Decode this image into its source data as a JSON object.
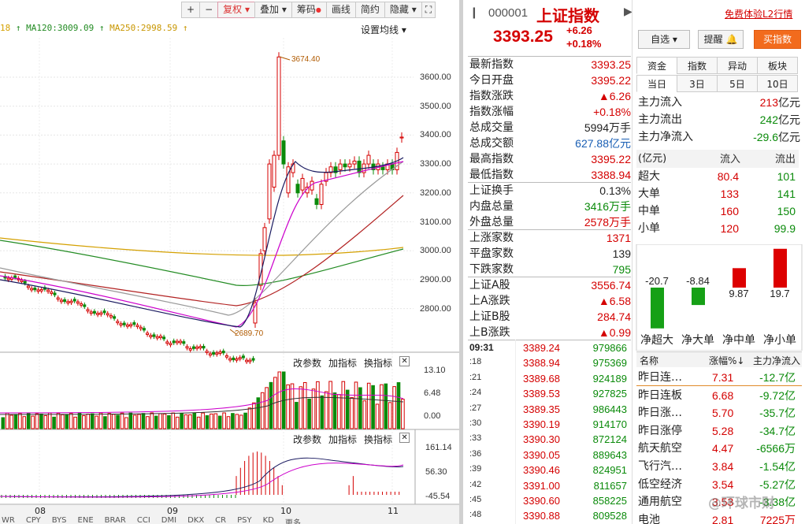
{
  "toolbar": {
    "plus": "+",
    "minus": "−",
    "fuquan": "复权",
    "diejia": "叠加",
    "chouma": "筹码",
    "huaxian": "画线",
    "jianyue": "简约",
    "yincang": "隐藏"
  },
  "ma_legend": {
    "ma_prefix": "18",
    "ma120": "MA120:3009.09",
    "ma250": "MA250:2998.59",
    "arrow": "↑"
  },
  "set_ma": "设置均线",
  "price_labels": [
    "3600.00",
    "3500.00",
    "3400.00",
    "3300.00",
    "3200.00",
    "3100.00",
    "3000.00",
    "2900.00",
    "2800.00"
  ],
  "annotations": {
    "high": "3674.40",
    "low": "2689.70"
  },
  "vol_labels": [
    "13.10",
    "6.48",
    "0.00"
  ],
  "macd_labels": [
    "161.14",
    "56.30",
    "-45.54"
  ],
  "indicator_bar": {
    "change": "改参数",
    "add": "加指标",
    "swap": "换指标"
  },
  "x_labels": [
    "08",
    "09",
    "10",
    "11"
  ],
  "quote": {
    "code": "000001",
    "name": "上证指数",
    "price": "3393.25",
    "chg": "+6.26",
    "pct": "+0.18%",
    "free_l2": "免费体验L2行情",
    "zixuan": "自选",
    "tixing": "提醒",
    "buy": "买指数"
  },
  "stats": [
    {
      "l": "最新指数",
      "r": "3393.25",
      "c": "red"
    },
    {
      "l": "今日开盘",
      "r": "3395.22",
      "c": "red"
    },
    {
      "l": "指数涨跌",
      "r": "▲6.26",
      "c": "red"
    },
    {
      "l": "指数涨幅",
      "r": "+0.18%",
      "c": "red"
    },
    {
      "l": "总成交量",
      "r": "5994万手",
      "c": ""
    },
    {
      "l": "总成交额",
      "r": "627.88亿元",
      "c": "blue"
    },
    {
      "l": "最高指数",
      "r": "3395.22",
      "c": "red"
    },
    {
      "l": "最低指数",
      "r": "3388.94",
      "c": "red"
    },
    {
      "l": "上证换手",
      "r": "0.13%",
      "c": ""
    },
    {
      "l": "内盘总量",
      "r": "3416万手",
      "c": "green"
    },
    {
      "l": "外盘总量",
      "r": "2578万手",
      "c": "red"
    },
    {
      "l": "上涨家数",
      "r": "1371",
      "c": "red"
    },
    {
      "l": "平盘家数",
      "r": "139",
      "c": ""
    },
    {
      "l": "下跌家数",
      "r": "795",
      "c": "green"
    },
    {
      "l": "上证A股",
      "r": "3556.74",
      "c": "red"
    },
    {
      "l": "上A涨跌",
      "r": "▲6.58",
      "c": "red"
    },
    {
      "l": "上证B股",
      "r": "284.74",
      "c": "red"
    },
    {
      "l": "上B涨跌",
      "r": "▲0.99",
      "c": "red"
    }
  ],
  "ticks": [
    {
      "t": "09:31",
      "p": "3389.24",
      "v": "979866"
    },
    {
      "t": ":18",
      "p": "3388.94",
      "v": "975369"
    },
    {
      "t": ":21",
      "p": "3389.68",
      "v": "924189"
    },
    {
      "t": ":24",
      "p": "3389.53",
      "v": "927825"
    },
    {
      "t": ":27",
      "p": "3389.35",
      "v": "986443"
    },
    {
      "t": ":30",
      "p": "3390.19",
      "v": "914170"
    },
    {
      "t": ":33",
      "p": "3390.30",
      "v": "872124"
    },
    {
      "t": ":36",
      "p": "3390.05",
      "v": "889643"
    },
    {
      "t": ":39",
      "p": "3390.46",
      "v": "824951"
    },
    {
      "t": ":42",
      "p": "3391.00",
      "v": "811657"
    },
    {
      "t": ":45",
      "p": "3390.60",
      "v": "858225"
    },
    {
      "t": ":48",
      "p": "3390.88",
      "v": "809528"
    }
  ],
  "tabs": {
    "zijin": "资金",
    "zhishu": "指数",
    "yidong": "异动",
    "bankuai": "板块",
    "dangri": "当日",
    "d3": "3日",
    "d5": "5日",
    "d10": "10日"
  },
  "flows": [
    {
      "l": "主力流入",
      "v": "213",
      "u": "亿元",
      "c": "red"
    },
    {
      "l": "主力流出",
      "v": "242",
      "u": "亿元",
      "c": "green"
    },
    {
      "l": "主力净流入",
      "v": "-29.6",
      "u": "亿元",
      "c": "green"
    }
  ],
  "sec_header": {
    "unit": "(亿元)",
    "in": "流入",
    "out": "流出"
  },
  "secs": [
    {
      "n": "超大",
      "in": "80.4",
      "out": "101"
    },
    {
      "n": "大单",
      "in": "133",
      "out": "141"
    },
    {
      "n": "中单",
      "in": "160",
      "out": "150"
    },
    {
      "n": "小单",
      "in": "120",
      "out": "99.9"
    }
  ],
  "net_bars": [
    {
      "label": "净超大",
      "value": -20.7,
      "text": "-20.7"
    },
    {
      "label": "净大单",
      "value": -8.84,
      "text": "-8.84"
    },
    {
      "label": "净中单",
      "value": 9.87,
      "text": "9.87"
    },
    {
      "label": "净小单",
      "value": 19.7,
      "text": "19.7"
    }
  ],
  "sector_header": {
    "name": "名称",
    "pct": "涨幅%↓",
    "net": "主力净流入"
  },
  "sectors": [
    {
      "n": "昨日连…",
      "p": "7.31",
      "f": "-12.7亿"
    },
    {
      "n": "昨日连板",
      "p": "6.68",
      "f": "-9.72亿"
    },
    {
      "n": "昨日涨…",
      "p": "5.70",
      "f": "-35.7亿"
    },
    {
      "n": "昨日涨停",
      "p": "5.28",
      "f": "-34.7亿"
    },
    {
      "n": "航天航空",
      "p": "4.47",
      "f": "-6566万"
    },
    {
      "n": "飞行汽…",
      "p": "3.84",
      "f": "-1.54亿"
    },
    {
      "n": "低空经济",
      "p": "3.54",
      "f": "-5.27亿"
    },
    {
      "n": "通用航空",
      "p": "3.53",
      "f": "-3.38亿"
    },
    {
      "n": "电池",
      "p": "2.81",
      "f": "7225万"
    }
  ],
  "watermark": "@环球市财",
  "bottom_tabs": [
    "WR",
    "CPY",
    "BYS",
    "ENE",
    "BRAR",
    "CCI",
    "DMI",
    "DKX",
    "CR",
    "PSY",
    "KD",
    "更多"
  ],
  "colors": {
    "up": "#d40000",
    "down": "#0a8a0a",
    "ma5": "#1a1a60",
    "ma10": "#cc00cc",
    "ma20": "#999999",
    "ma60": "#b22222",
    "ma120": "#228b22",
    "ma250": "#d4a000"
  }
}
